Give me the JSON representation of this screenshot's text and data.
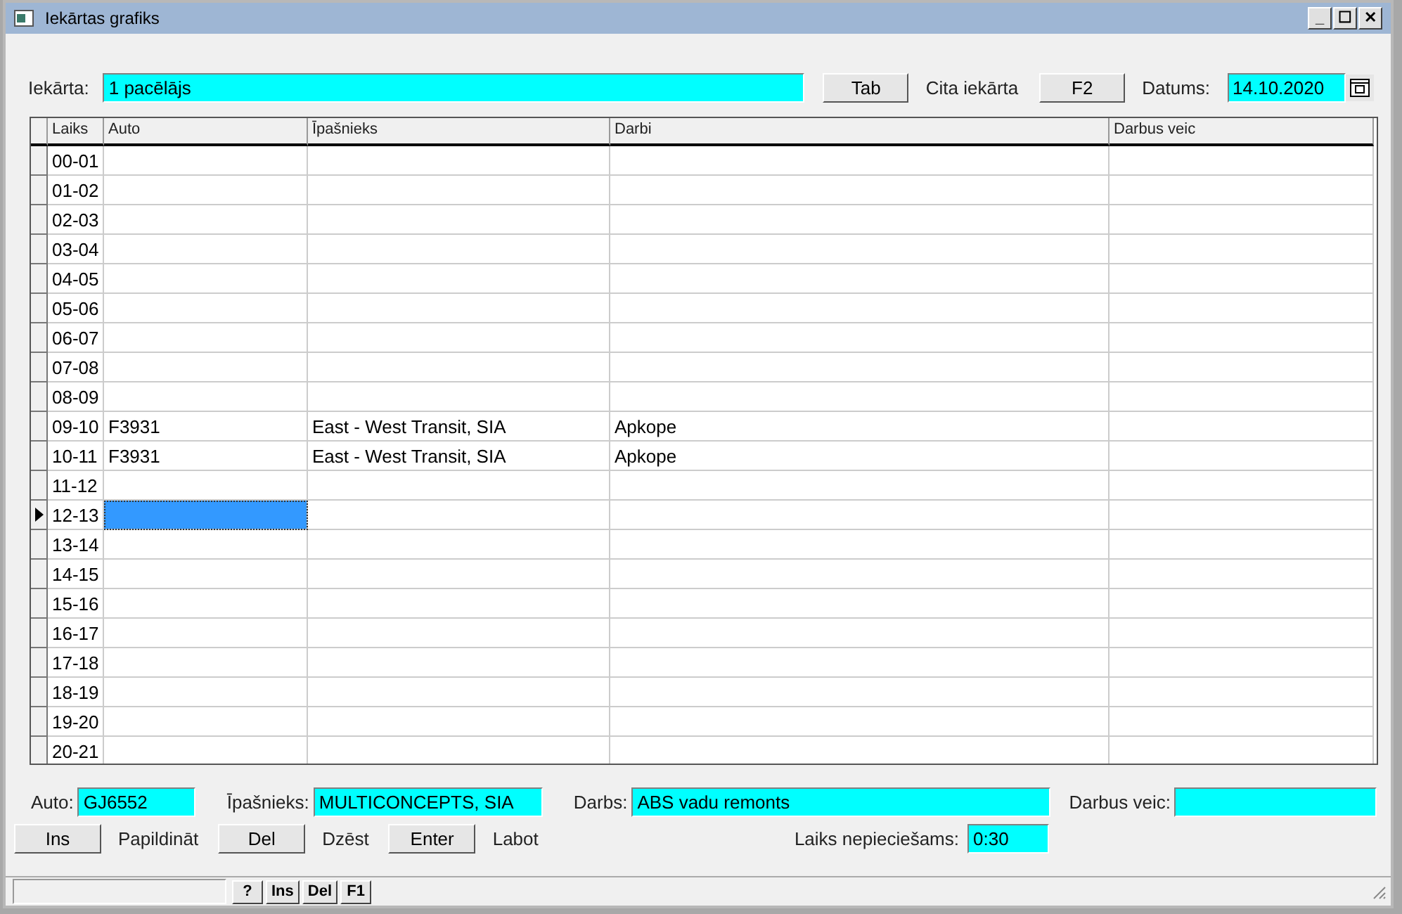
{
  "window": {
    "title": "Iekārtas grafiks",
    "controls": [
      "_",
      "☐",
      "✕"
    ]
  },
  "toolbar": {
    "device_label": "Iekārta:",
    "device_value": "1 pacēlājs",
    "tab_button": "Tab",
    "other_label": "Cita iekārta",
    "f2_button": "F2",
    "date_label": "Datums:",
    "date_value": "14.10.2020"
  },
  "table": {
    "columns": [
      "Laiks",
      "Auto",
      "Īpašnieks",
      "Darbi",
      "Darbus veic"
    ],
    "rows": [
      {
        "time": "00-01",
        "auto": "",
        "owner": "",
        "work": "",
        "worker": "",
        "selected": false
      },
      {
        "time": "01-02",
        "auto": "",
        "owner": "",
        "work": "",
        "worker": "",
        "selected": false
      },
      {
        "time": "02-03",
        "auto": "",
        "owner": "",
        "work": "",
        "worker": "",
        "selected": false
      },
      {
        "time": "03-04",
        "auto": "",
        "owner": "",
        "work": "",
        "worker": "",
        "selected": false
      },
      {
        "time": "04-05",
        "auto": "",
        "owner": "",
        "work": "",
        "worker": "",
        "selected": false
      },
      {
        "time": "05-06",
        "auto": "",
        "owner": "",
        "work": "",
        "worker": "",
        "selected": false
      },
      {
        "time": "06-07",
        "auto": "",
        "owner": "",
        "work": "",
        "worker": "",
        "selected": false
      },
      {
        "time": "07-08",
        "auto": "",
        "owner": "",
        "work": "",
        "worker": "",
        "selected": false
      },
      {
        "time": "08-09",
        "auto": "",
        "owner": "",
        "work": "",
        "worker": "",
        "selected": false
      },
      {
        "time": "09-10",
        "auto": "F3931",
        "owner": "East - West Transit, SIA",
        "work": "Apkope",
        "worker": "",
        "selected": false
      },
      {
        "time": "10-11",
        "auto": "F3931",
        "owner": "East - West Transit, SIA",
        "work": "Apkope",
        "worker": "",
        "selected": false
      },
      {
        "time": "11-12",
        "auto": "",
        "owner": "",
        "work": "",
        "worker": "",
        "selected": false
      },
      {
        "time": "12-13",
        "auto": "",
        "owner": "",
        "work": "",
        "worker": "",
        "selected": true
      },
      {
        "time": "13-14",
        "auto": "",
        "owner": "",
        "work": "",
        "worker": "",
        "selected": false
      },
      {
        "time": "14-15",
        "auto": "",
        "owner": "",
        "work": "",
        "worker": "",
        "selected": false
      },
      {
        "time": "15-16",
        "auto": "",
        "owner": "",
        "work": "",
        "worker": "",
        "selected": false
      },
      {
        "time": "16-17",
        "auto": "",
        "owner": "",
        "work": "",
        "worker": "",
        "selected": false
      },
      {
        "time": "17-18",
        "auto": "",
        "owner": "",
        "work": "",
        "worker": "",
        "selected": false
      },
      {
        "time": "18-19",
        "auto": "",
        "owner": "",
        "work": "",
        "worker": "",
        "selected": false
      },
      {
        "time": "19-20",
        "auto": "",
        "owner": "",
        "work": "",
        "worker": "",
        "selected": false
      },
      {
        "time": "20-21",
        "auto": "",
        "owner": "",
        "work": "",
        "worker": "",
        "selected": false
      }
    ]
  },
  "details": {
    "auto_label": "Auto:",
    "auto_value": "GJ6552",
    "owner_label": "Īpašnieks:",
    "owner_value": "MULTICONCEPTS, SIA",
    "work_label": "Darbs:",
    "work_value": "ABS vadu remonts",
    "worker_label": "Darbus veic:",
    "time_label": "Laiks nepieciešams:",
    "time_value": "0:30"
  },
  "actions": [
    {
      "key": "Ins",
      "label": "Papildināt"
    },
    {
      "key": "Del",
      "label": "Dzēst"
    },
    {
      "key": "Enter",
      "label": "Labot"
    }
  ],
  "status_bar": {
    "keys": [
      "?",
      "Ins",
      "Del",
      "F1"
    ]
  }
}
